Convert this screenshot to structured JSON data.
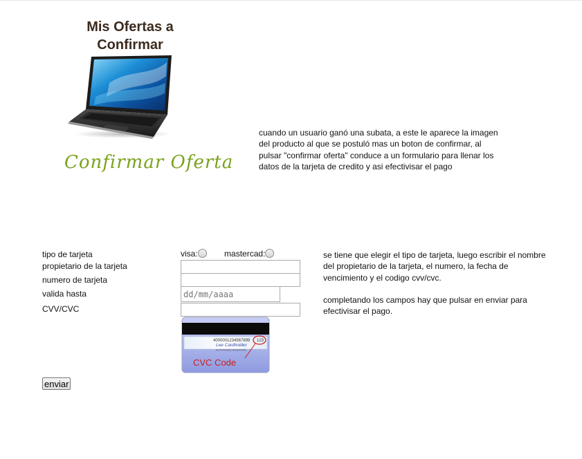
{
  "header": {
    "title": "Mis Ofertas a Confirmar"
  },
  "offer": {
    "confirm_link": "Confirmar Oferta",
    "description": "cuando un usuario ganó una subata, a este le aparece la imagen del producto al que se postuló mas un boton de confirmar, al pulsar \"confirmar oferta\" conduce a un formulario para llenar los datos de la tarjeta de credito y asi efectivisar el pago"
  },
  "form": {
    "labels": {
      "card_type": "tipo de tarjeta",
      "owner": "propietario de la tarjeta",
      "number": "numero de tarjeta",
      "valid_until": "valida hasta",
      "cvv": "CVV/CVC"
    },
    "radio_options": [
      "visa:",
      "mastercad:"
    ],
    "date_placeholder": "dd/mm/aaaa",
    "card_image": {
      "number_text": "4000001234567899",
      "cvc_digits": "123",
      "signature": "Lee Cardholder",
      "strip_caption": "AUTHORIZED SIGNATURE",
      "caption": "CVC Code"
    },
    "submit_label": "enviar",
    "help_text": [
      "se tiene que elegir el tipo de tarjeta, luego escribir el nombre del propietario de la tarjeta, el numero, la fecha de vencimiento y el codigo cvv/cvc.",
      "completando los campos hay que pulsar en enviar para efectivisar el pago."
    ]
  },
  "colors": {
    "heading": "#3b2b1e",
    "confirm_link": "#79a21b",
    "cvc_highlight": "#cc1f1f"
  }
}
